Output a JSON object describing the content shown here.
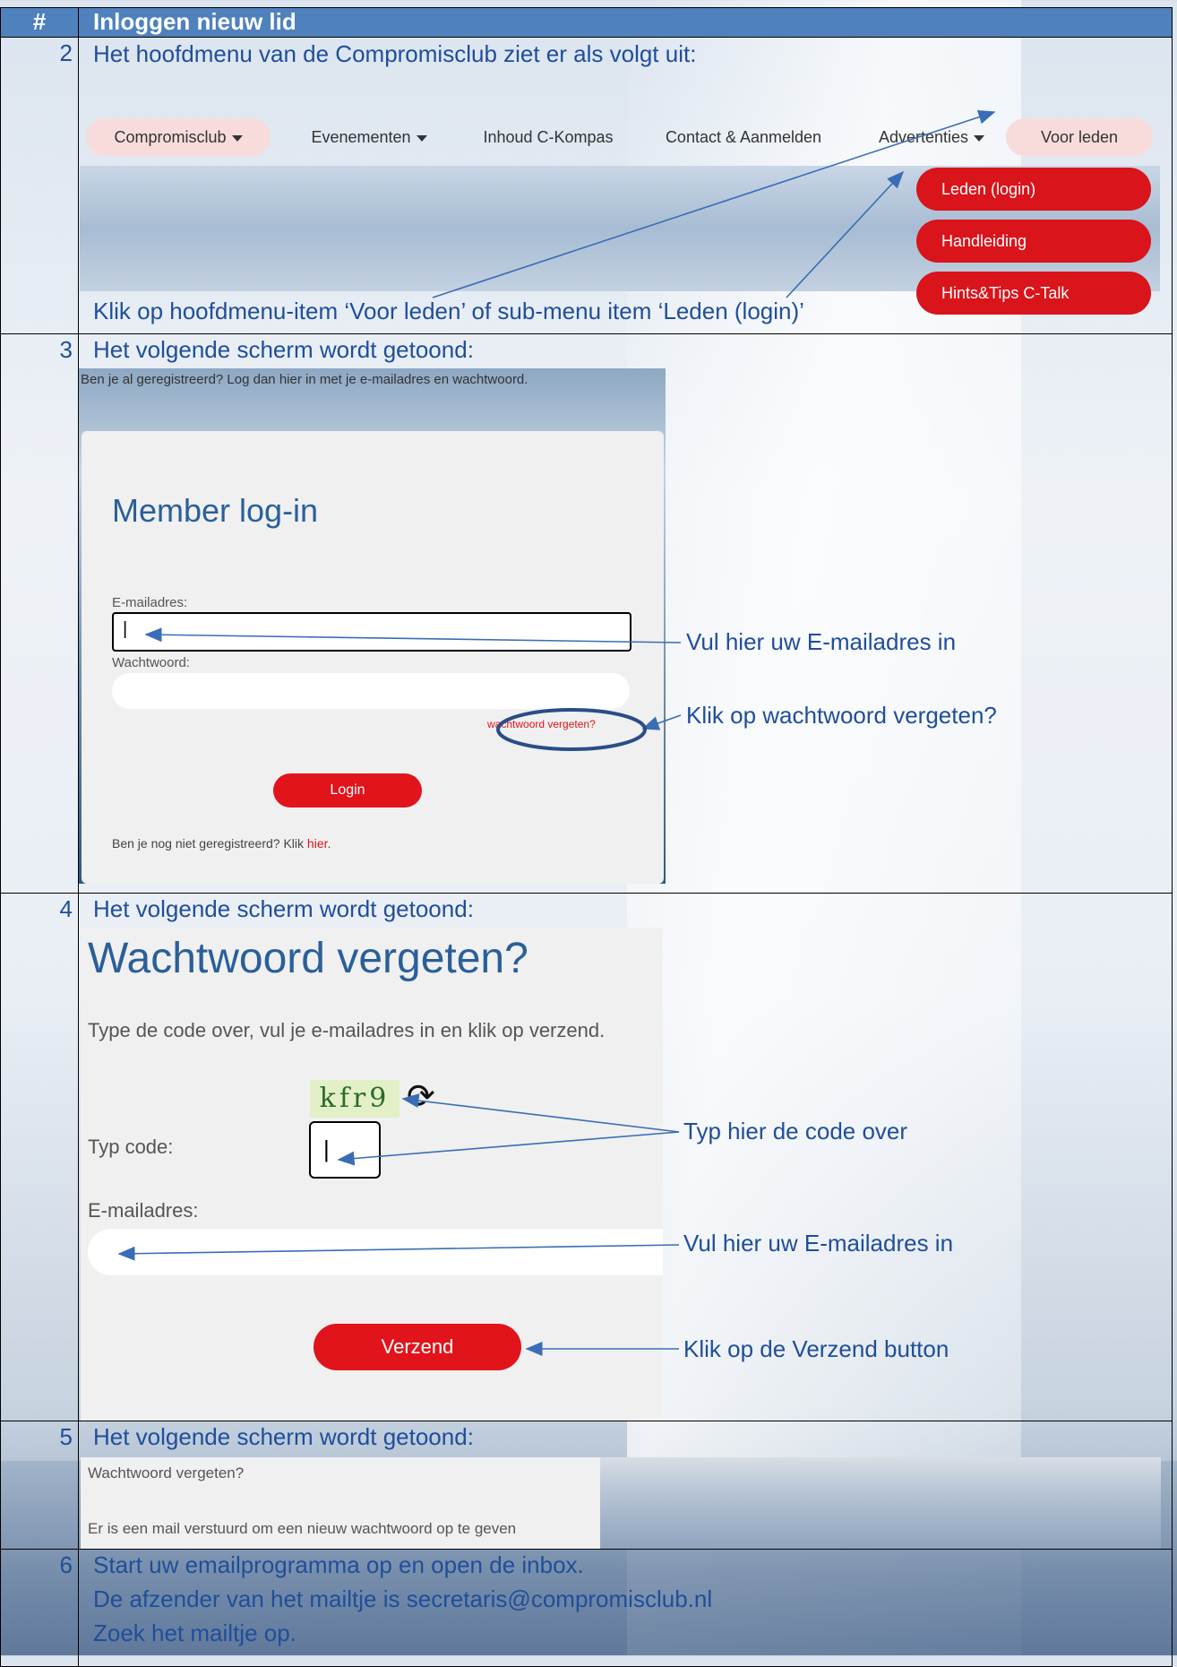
{
  "table": {
    "header_num": "#",
    "header_title": "Inloggen nieuw lid"
  },
  "step2": {
    "num": "2",
    "intro": "Het hoofdmenu van de Compromisclub ziet er als volgt uit:",
    "menu": {
      "compromisclub": "Compromisclub",
      "evenementen": "Evenementen",
      "inhoud": "Inhoud C-Kompas",
      "contact": "Contact & Aanmelden",
      "advertenties": "Advertenties",
      "voor_leden": "Voor leden"
    },
    "submenu": [
      "Leden (login)",
      "Handleiding",
      "Hints&Tips C-Talk"
    ],
    "instruction": "Klik op hoofdmenu-item ‘Voor leden’ of sub-menu item ‘Leden (login)’"
  },
  "step3": {
    "num": "3",
    "intro": "Het volgende scherm wordt getoond:",
    "top_text": "Ben je al geregistreerd? Log dan hier in met je e-mailadres en wachtwoord.",
    "title": "Member log-in",
    "email_label": "E-mailadres:",
    "email_value": "|",
    "password_label": "Wachtwoord:",
    "forgot_link": "wachtwoord vergeten?",
    "login_button": "Login",
    "register_text": "Ben je nog niet geregistreerd? Klik ",
    "register_link": "hier",
    "register_end": ".",
    "callout_email": "Vul hier uw E-mailadres in",
    "callout_forgot": "Klik op wachtwoord vergeten?"
  },
  "step4": {
    "num": "4",
    "intro": "Het volgende scherm wordt getoond:",
    "title": "Wachtwoord vergeten?",
    "description": "Type de code over, vul je e-mailadres in en klik op verzend.",
    "captcha": "kfr9",
    "code_label": "Typ code:",
    "code_value": "|",
    "email_label": "E-mailadres:",
    "send_button": "Verzend",
    "callout_code": "Typ hier de code over",
    "callout_email": "Vul hier uw E-mailadres in",
    "callout_send": "Klik op de Verzend button"
  },
  "step5": {
    "num": "5",
    "intro": "Het volgende scherm wordt getoond:",
    "title": "Wachtwoord vergeten?",
    "message": "Er is een mail verstuurd om een nieuw wachtwoord op te geven"
  },
  "step6": {
    "num": "6",
    "line1": "Start uw emailprogramma op en open de inbox.",
    "line2": "De afzender van het mailtje is secretaris@compromisclub.nl",
    "line3": "Zoek het mailtje op."
  },
  "colors": {
    "header_bg": "#4f81bd",
    "text_blue": "#1f4e9a",
    "button_red": "#e0141a"
  }
}
